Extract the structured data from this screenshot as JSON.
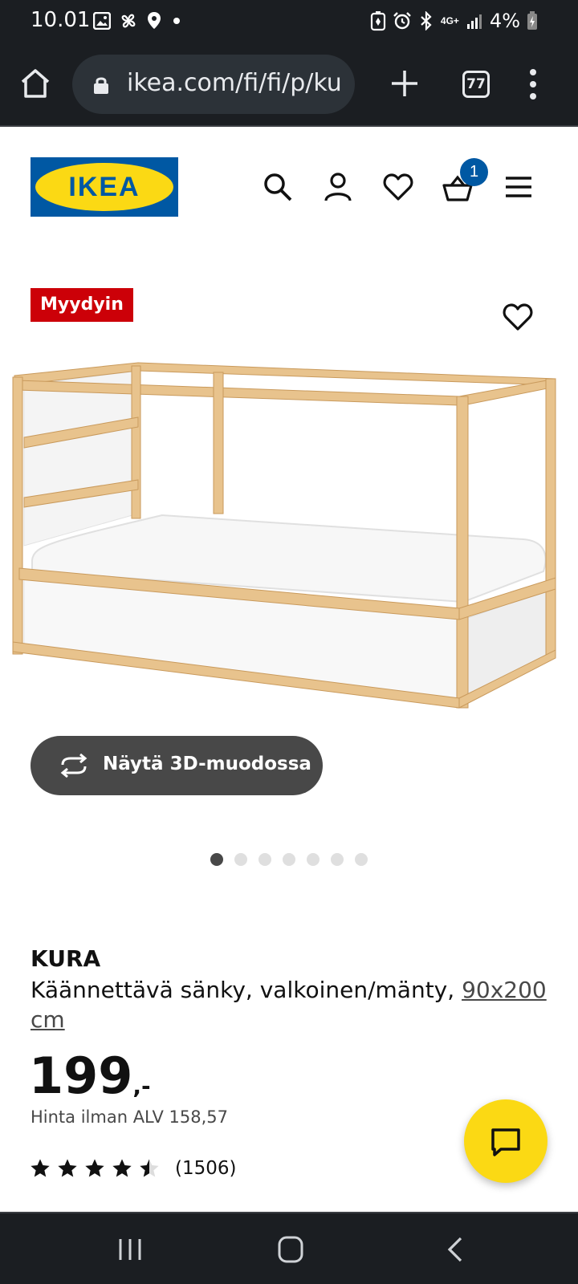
{
  "status_bar": {
    "time": "10.01",
    "network": "4G+",
    "battery": "4%"
  },
  "browser": {
    "url": "ikea.com/fi/fi/p/ku",
    "tab_count": "77"
  },
  "header": {
    "logo": "IKEA",
    "cart_count": "1"
  },
  "product_media": {
    "badge": "Myydyin",
    "view_3d_label": "Näytä 3D-muodossa",
    "image_count": 7,
    "active_image_index": 0
  },
  "product": {
    "name": "KURA",
    "description": "Käännettävä sänky, valkoinen/mänty,",
    "size": "90x200 cm",
    "price": "199",
    "price_suffix": ",-",
    "price_excl_vat": "Hinta ilman ALV 158,57",
    "rating_value": 4.5,
    "rating_count": "(1506)"
  },
  "colors": {
    "ikea_blue": "#0058a3",
    "ikea_yellow": "#fbd914",
    "badge_red": "#cc0008",
    "system_bar": "#1b1e22"
  }
}
